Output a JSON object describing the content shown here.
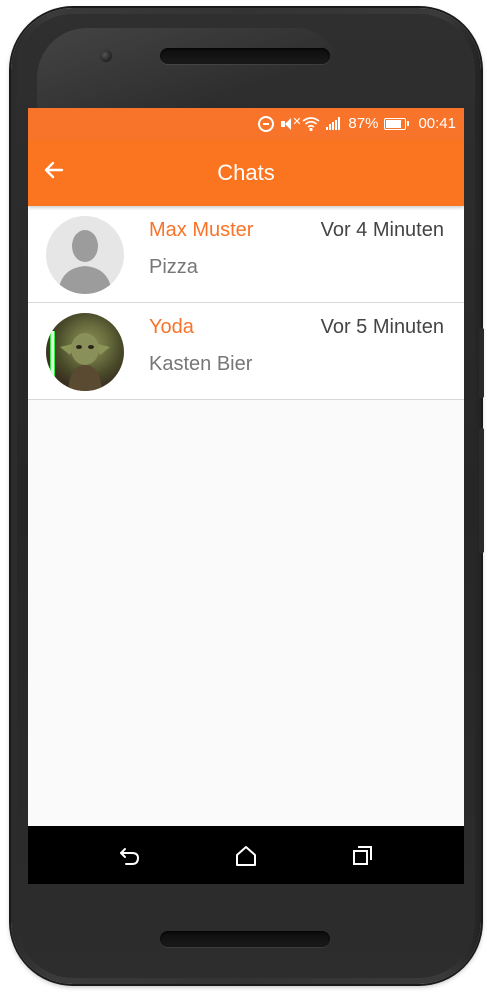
{
  "status_bar": {
    "battery": "87%",
    "time": "00:41",
    "icons": [
      "do-not-disturb-icon",
      "mute-icon",
      "wifi-icon",
      "signal-icon",
      "battery-icon"
    ]
  },
  "app_bar": {
    "title": "Chats",
    "back_icon": "arrow-left-icon",
    "color": "#fb741f"
  },
  "chats": [
    {
      "name": "Max Muster",
      "time": "Vor 4 Minuten",
      "message": "Pizza",
      "avatar": "default-person-avatar"
    },
    {
      "name": "Yoda",
      "time": "Vor 5 Minuten",
      "message": "Kasten Bier",
      "avatar": "yoda-avatar"
    }
  ],
  "nav_bar": {
    "icons": [
      "back-icon",
      "home-icon",
      "recents-icon"
    ]
  },
  "colors": {
    "accent": "#f7742a",
    "name_text": "#f7742a",
    "time_text": "#444444",
    "message_text": "#777777",
    "background": "#fafafa"
  }
}
